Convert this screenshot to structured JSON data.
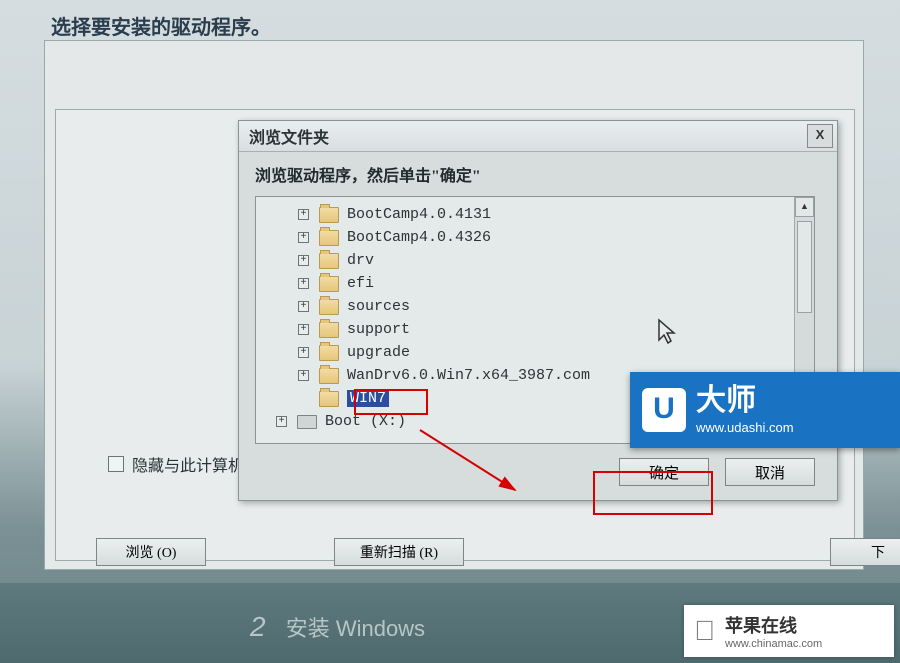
{
  "main": {
    "title": "选择要安装的驱动程序。",
    "browse_btn": "浏览 (O)",
    "rescan_btn": "重新扫描 (R)",
    "next_btn": "下",
    "hide_checkbox_label": "隐藏与此计算机上"
  },
  "dialog": {
    "title": "浏览文件夹",
    "instruction": "浏览驱动程序，然后单击\"确定\"",
    "close": "X",
    "ok": "确定",
    "cancel": "取消"
  },
  "tree": {
    "items": [
      {
        "label": "BootCamp4.0.4131",
        "level": 2,
        "expandable": true
      },
      {
        "label": "BootCamp4.0.4326",
        "level": 2,
        "expandable": true
      },
      {
        "label": "drv",
        "level": 2,
        "expandable": true
      },
      {
        "label": "efi",
        "level": 2,
        "expandable": true
      },
      {
        "label": "sources",
        "level": 2,
        "expandable": true
      },
      {
        "label": "support",
        "level": 2,
        "expandable": true
      },
      {
        "label": "upgrade",
        "level": 2,
        "expandable": true
      },
      {
        "label": "WanDrv6.0.Win7.x64_3987.com",
        "level": 2,
        "expandable": true
      },
      {
        "label": "WIN7",
        "level": 2,
        "expandable": false,
        "selected": true
      },
      {
        "label": "Boot (X:)",
        "level": 1,
        "expandable": true,
        "drive": true
      }
    ]
  },
  "watermark_udashi": {
    "logo": "U",
    "name": "大师",
    "url": "www.udashi.com"
  },
  "watermark_apple": {
    "name": "苹果在线",
    "url": "www.chinamac.com"
  },
  "taskbar": {
    "step_num": "2",
    "step_label": "安装 Windows"
  }
}
